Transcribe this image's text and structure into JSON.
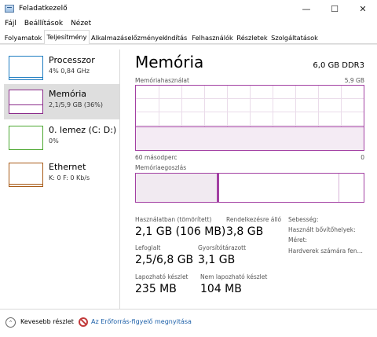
{
  "window": {
    "title": "Feladatkezelő",
    "controls": {
      "minimize": "—",
      "maximize": "☐",
      "close": "✕"
    }
  },
  "menu": [
    "Fájl",
    "Beállítások",
    "Nézet"
  ],
  "tabs": [
    "Folyamatok",
    "Teljesítmény",
    "Alkalmazáselőzmények",
    "Indítás",
    "Felhasználók",
    "Részletek",
    "Szolgáltatások"
  ],
  "active_tab": "Teljesítmény",
  "sidebar": {
    "items": [
      {
        "name": "Processzor",
        "sub": "4% 0,84 GHz",
        "color": "#1f7ec2",
        "selected": false
      },
      {
        "name": "Memória",
        "sub": "2,1/5,9 GB (36%)",
        "color": "#8b2d8b",
        "selected": true
      },
      {
        "name": "0. lemez (C: D:)",
        "sub": "0%",
        "color": "#4da832",
        "selected": false
      },
      {
        "name": "Ethernet",
        "sub": "K: 0 F: 0 Kb/s",
        "color": "#a85b17",
        "selected": false
      }
    ]
  },
  "memory": {
    "title": "Memória",
    "type": "6,0 GB DDR3",
    "usage_label": "Memóriahasználat",
    "usage_max": "5,9 GB",
    "time_label": "60 másodperc",
    "time_end": "0",
    "composition_label": "Memóriaegoszlás",
    "usage_fraction": 0.36,
    "stats": {
      "in_use_label": "Használatban (tömörített)",
      "in_use_value": "2,1 GB (106 MB)",
      "available_label": "Rendelkezésre álló",
      "available_value": "3,8 GB",
      "committed_label": "Lefoglalt",
      "committed_value": "2,5/6,8 GB",
      "cached_label": "Gyorsítótárazott",
      "cached_value": "3,1 GB",
      "paged_label": "Lapozható készlet",
      "paged_value": "235 MB",
      "nonpaged_label": "Nem lapozható készlet",
      "nonpaged_value": "104 MB",
      "speed_label": "Sebesség:",
      "slots_label": "Használt bővítőhelyek:",
      "form_label": "Méret:",
      "reserved_label": "Hardverek számára fen..."
    }
  },
  "footer": {
    "fewer": "Kevesebb részlet",
    "monitor": "Az Erőforrás-figyelő megnyitása"
  }
}
